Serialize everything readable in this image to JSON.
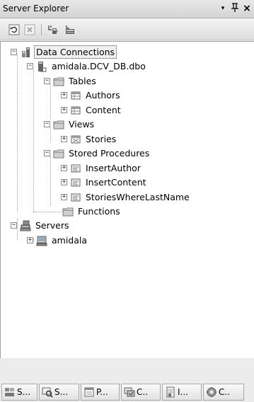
{
  "window": {
    "title": "Server Explorer",
    "dropdown_glyph": "▾",
    "pin_glyph": "ᛘ",
    "close_glyph": "×"
  },
  "toolbar": {
    "buttons": [
      {
        "name": "refresh-icon"
      },
      {
        "name": "stop-refresh-icon"
      },
      {
        "name": "connect-to-database-icon"
      },
      {
        "name": "connect-to-server-icon"
      }
    ]
  },
  "tree": {
    "nodes": [
      {
        "label": "Data Connections",
        "expander": "−",
        "icon": "data-connections-icon",
        "selected": true
      },
      {
        "label": "amidala.DCV_DB.dbo",
        "expander": "−",
        "icon": "database-icon"
      },
      {
        "label": "Tables",
        "expander": "−",
        "icon": "folder-icon"
      },
      {
        "label": "Authors",
        "expander": "+",
        "icon": "table-icon"
      },
      {
        "label": "Content",
        "expander": "+",
        "icon": "table-icon"
      },
      {
        "label": "Views",
        "expander": "−",
        "icon": "folder-icon"
      },
      {
        "label": "Stories",
        "expander": "+",
        "icon": "view-icon"
      },
      {
        "label": "Stored Procedures",
        "expander": "−",
        "icon": "folder-icon"
      },
      {
        "label": "InsertAuthor",
        "expander": "+",
        "icon": "stored-procedure-icon"
      },
      {
        "label": "InsertContent",
        "expander": "+",
        "icon": "stored-procedure-icon"
      },
      {
        "label": "StoriesWhereLastName",
        "expander": "+",
        "icon": "stored-procedure-icon"
      },
      {
        "label": "Functions",
        "expander": "",
        "icon": "folder-icon"
      },
      {
        "label": "Servers",
        "expander": "−",
        "icon": "servers-icon"
      },
      {
        "label": "amidala",
        "expander": "+",
        "icon": "server-computer-icon"
      }
    ]
  },
  "tabs": [
    {
      "label": "S...",
      "icon": "solution-explorer-icon"
    },
    {
      "label": "S...",
      "icon": "server-explorer-icon"
    },
    {
      "label": "P...",
      "icon": "properties-icon"
    },
    {
      "label": "C..",
      "icon": "class-view-icon"
    },
    {
      "label": "I...",
      "icon": "index-icon"
    },
    {
      "label": "C..",
      "icon": "contents-icon"
    }
  ]
}
